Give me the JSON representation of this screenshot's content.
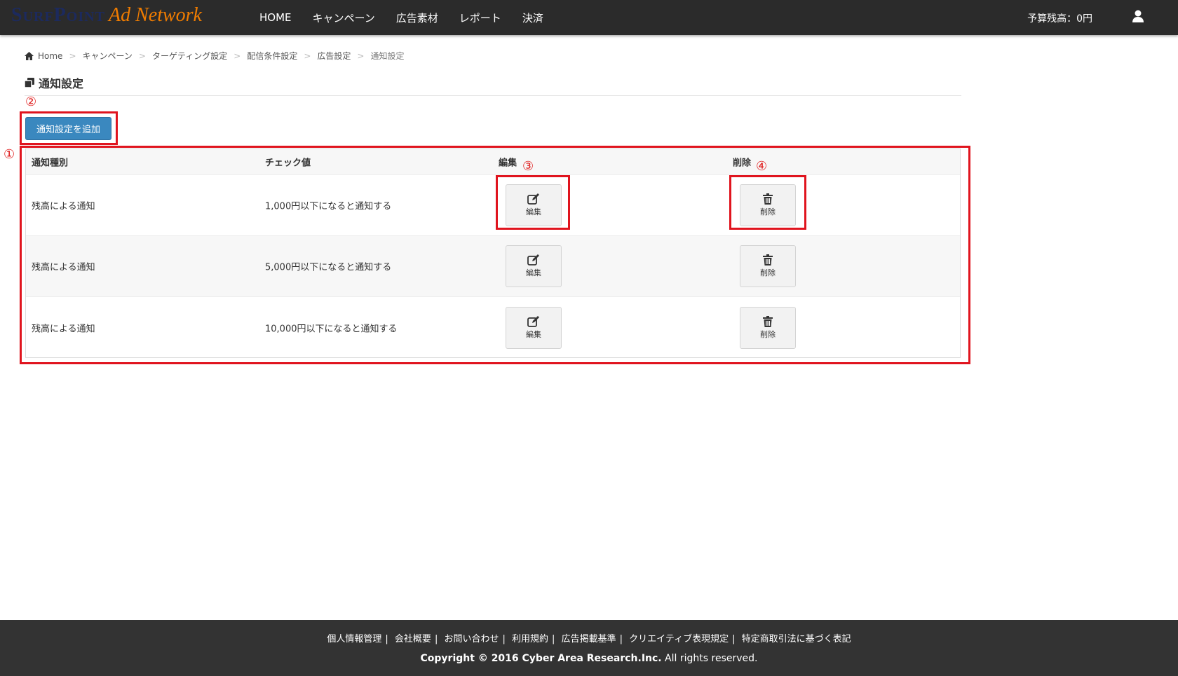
{
  "header": {
    "logo_part1": "SurfPoint",
    "logo_part2": "Ad Network",
    "menu": [
      "HOME",
      "キャンペーン",
      "広告素材",
      "レポート",
      "決済"
    ],
    "budget": "予算残高：0円"
  },
  "breadcrumb": [
    "Home",
    "キャンペーン",
    "ターゲティング設定",
    "配信条件設定",
    "広告設定",
    "通知設定"
  ],
  "page_title": "通知設定",
  "add_button": "通知設定を追加",
  "annotations": [
    "①",
    "②",
    "③",
    "④"
  ],
  "table": {
    "headers": [
      "通知種別",
      "チェック値",
      "編集",
      "削除"
    ],
    "rows": [
      {
        "type": "残高による通知",
        "value": "1,000円以下になると通知する"
      },
      {
        "type": "残高による通知",
        "value": "5,000円以下になると通知する"
      },
      {
        "type": "残高による通知",
        "value": "10,000円以下になると通知する"
      }
    ],
    "edit_label": "編集",
    "delete_label": "削除"
  },
  "footer": {
    "links": [
      "個人情報管理",
      "会社概要",
      "お問い合わせ",
      "利用規約",
      "広告掲載基準",
      "クリエイティブ表現規定",
      "特定商取引法に基づく表記"
    ],
    "copyright_bold": "Copyright © 2016 Cyber Area Research.Inc.",
    "copyright_rest": " All rights reserved."
  },
  "colors": {
    "nav": "#2b2b2b",
    "primary": "#3a88bf",
    "annotation": "#e0141e",
    "accent": "#f07c00"
  }
}
